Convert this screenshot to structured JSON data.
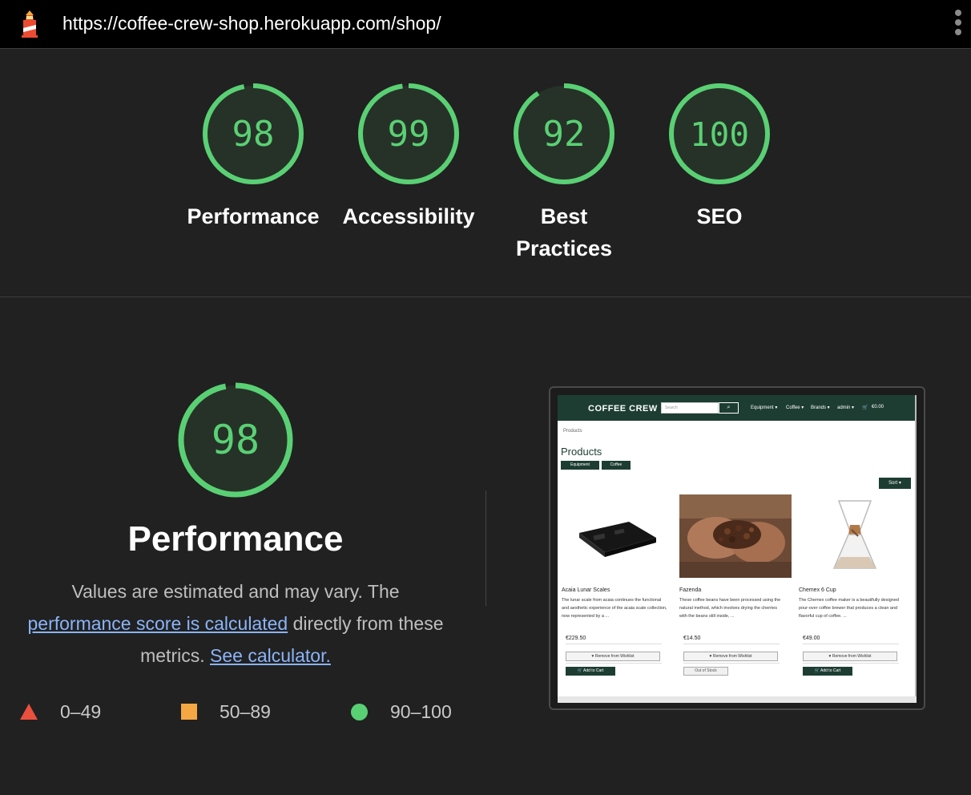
{
  "url_bar": {
    "url": "https://coffee-crew-shop.herokuapp.com/shop/",
    "logo_icon": "lighthouse-icon",
    "menu_icon": "kebab-menu-icon"
  },
  "gauges": [
    {
      "score": "98",
      "label": "Performance",
      "value": 98
    },
    {
      "score": "99",
      "label": "Accessibility",
      "value": 99
    },
    {
      "score": "92",
      "label_line1": "Best",
      "label_line2": "Practices",
      "value": 92
    },
    {
      "score": "100",
      "label": "SEO",
      "value": 100
    }
  ],
  "performance": {
    "score": "98",
    "value": 98,
    "title": "Performance",
    "desc_before": "Values are estimated and may vary. The ",
    "desc_link": "performance score is calculated",
    "desc_middle": " directly from these metrics. ",
    "desc_link2": "See calculator."
  },
  "legend": {
    "fail": "0–49",
    "average": "50–89",
    "pass": "90–100"
  },
  "colors": {
    "pass": "#5ad074",
    "average": "#f4a742",
    "fail": "#eb4f3e",
    "link": "#8ab4f8",
    "shop_green": "#1d3d33"
  },
  "thumbnail": {
    "brand": "COFFEE CREW",
    "search_placeholder": "Search",
    "nav": [
      "Equipment ▾",
      "Coffee ▾",
      "Brands ▾",
      "admin ▾",
      "€0.00"
    ],
    "breadcrumb": "Products",
    "heading": "Products",
    "chips": [
      "Equipment",
      "Coffee"
    ],
    "sort": "Sort ▾",
    "products": [
      {
        "name": "Acaia Lunar Scales",
        "desc": "The lunar scale from acaia continues the functional and aesthetic experience of the acaia scale collection, now represented by a ...",
        "price": "€229.50",
        "wishlist": "Remove from Wishlist",
        "action": "Add to Cart"
      },
      {
        "name": "Fazenda",
        "desc": "These coffee beans have been processed using the natural method, which involves drying the cherries with the beans still inside, ...",
        "price": "€14.50",
        "wishlist": "Remove from Wishlist",
        "action": "Out of Stock"
      },
      {
        "name": "Chemex 6 Cup",
        "desc": "The Chemex coffee maker is a beautifully designed pour-over coffee brewer that produces a clean and flavorful cup of coffee. ...",
        "price": "€49.00",
        "wishlist": "Remove from Wishlist",
        "action": "Add to Cart"
      }
    ]
  }
}
